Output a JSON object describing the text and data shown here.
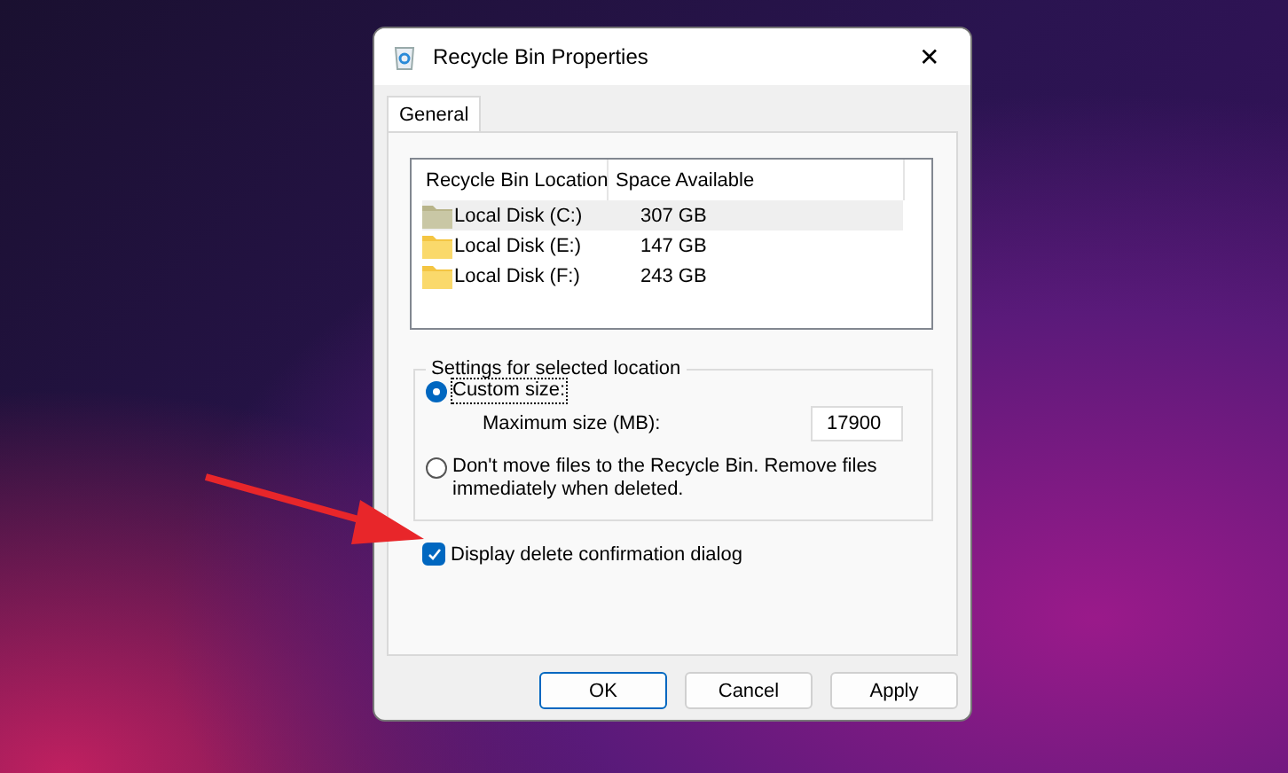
{
  "window": {
    "title": "Recycle Bin Properties",
    "close": "✕"
  },
  "tabs": [
    {
      "label": "General",
      "selected": true
    }
  ],
  "locations": {
    "columns": [
      "Recycle Bin Location",
      "Space Available"
    ],
    "rows": [
      {
        "name": "Local Disk (C:)",
        "space": "307 GB",
        "selected": true
      },
      {
        "name": "Local Disk (E:)",
        "space": "147 GB",
        "selected": false
      },
      {
        "name": "Local Disk (F:)",
        "space": "243 GB",
        "selected": false
      }
    ]
  },
  "settings": {
    "legend": "Settings for selected location",
    "options": [
      {
        "kind": "custom",
        "label": "Custom size:",
        "selected": true,
        "size_field": {
          "label": "Maximum size (MB):",
          "value": "17900"
        }
      },
      {
        "kind": "plain",
        "label": "Don't move files to the Recycle Bin. Remove files immediately when deleted.",
        "selected": false
      }
    ]
  },
  "confirm": {
    "label": "Display delete confirmation dialog",
    "checked": true
  },
  "buttons": [
    {
      "label": "OK",
      "default": true
    },
    {
      "label": "Cancel",
      "default": false
    },
    {
      "label": "Apply",
      "default": false
    }
  ]
}
